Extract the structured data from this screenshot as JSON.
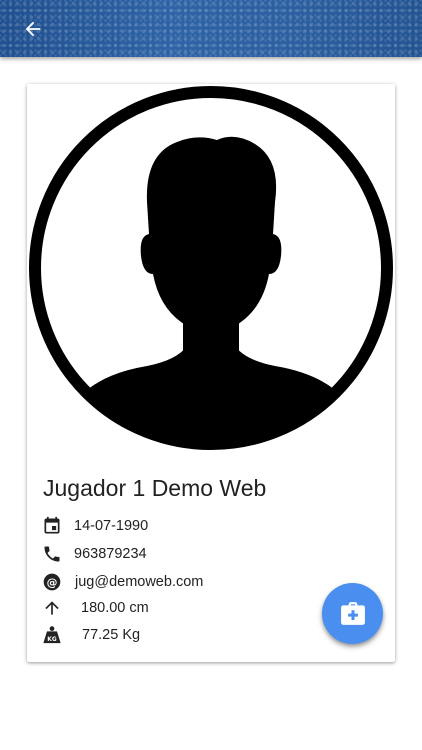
{
  "app_bar": {
    "back_icon": "arrow-back-icon"
  },
  "player": {
    "name": "Jugador 1 Demo Web",
    "avatar_icon": "person-silhouette-icon",
    "details": [
      {
        "icon": "calendar-icon",
        "value": "14-07-1990"
      },
      {
        "icon": "phone-icon",
        "value": "963879234"
      },
      {
        "icon": "at-sign-icon",
        "value": "jug@demoweb.com"
      },
      {
        "icon": "arrow-up-icon",
        "value": "180.00 cm"
      },
      {
        "icon": "weight-kg-icon",
        "value": "77.25 Kg"
      }
    ]
  },
  "fab": {
    "icon": "medical-kit-icon"
  },
  "colors": {
    "app_bar": "#2a5c9c",
    "fab": "#4a8ff0",
    "text": "#222222"
  }
}
